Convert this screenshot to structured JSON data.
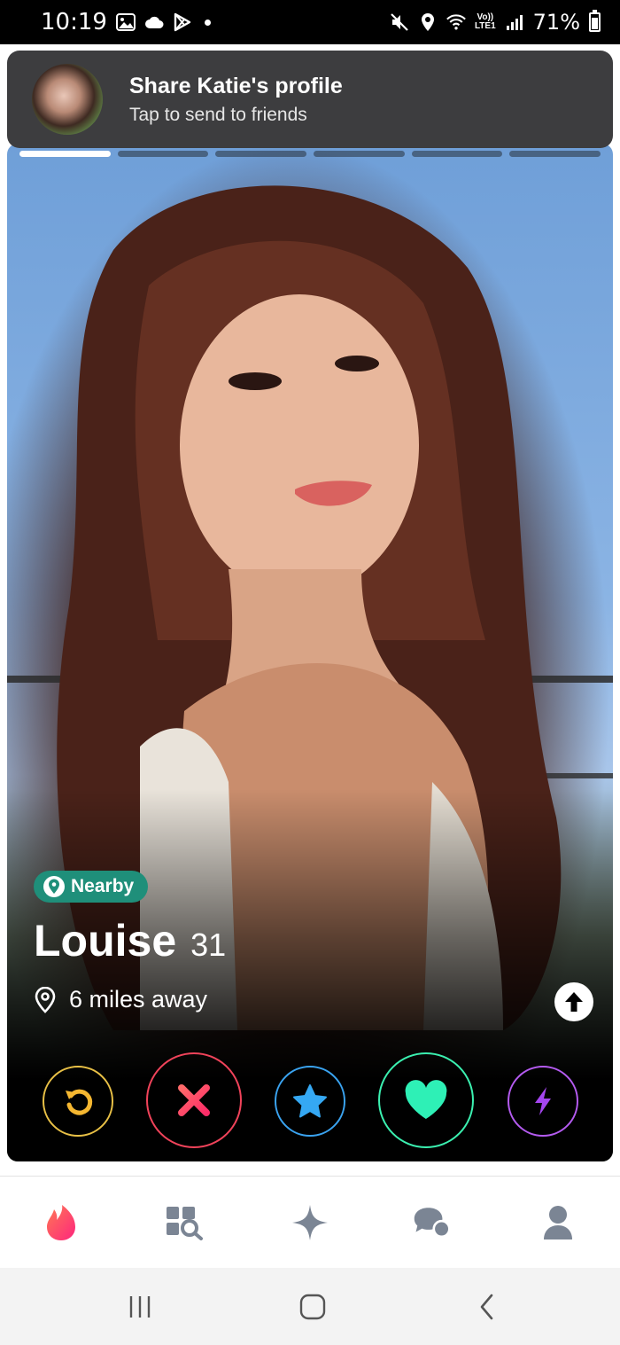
{
  "status_bar": {
    "time": "10:19",
    "battery": "71%",
    "network_badge_top": "Vo))",
    "network_badge_bottom": "LTE1"
  },
  "notification": {
    "title": "Share Katie's profile",
    "subtitle": "Tap to send to friends"
  },
  "card": {
    "photo_count": 6,
    "current_photo": 1,
    "badge": "Nearby",
    "name": "Louise",
    "age": "31",
    "distance": "6 miles away"
  },
  "actions": [
    "rewind-icon",
    "close-icon",
    "star-icon",
    "heart-icon",
    "bolt-icon"
  ],
  "colors": {
    "rewind": "#e8c046",
    "nope": "#f0435a",
    "super_like": "#3aa3f0",
    "like": "#3bf0b0",
    "boost": "#b45bf0",
    "nearby_badge": "#1f8f7a",
    "tinder_flame": "#fd3a5b"
  },
  "tabs": [
    "flame-icon",
    "explore-icon",
    "sparkle-icon",
    "chat-icon",
    "profile-icon"
  ]
}
